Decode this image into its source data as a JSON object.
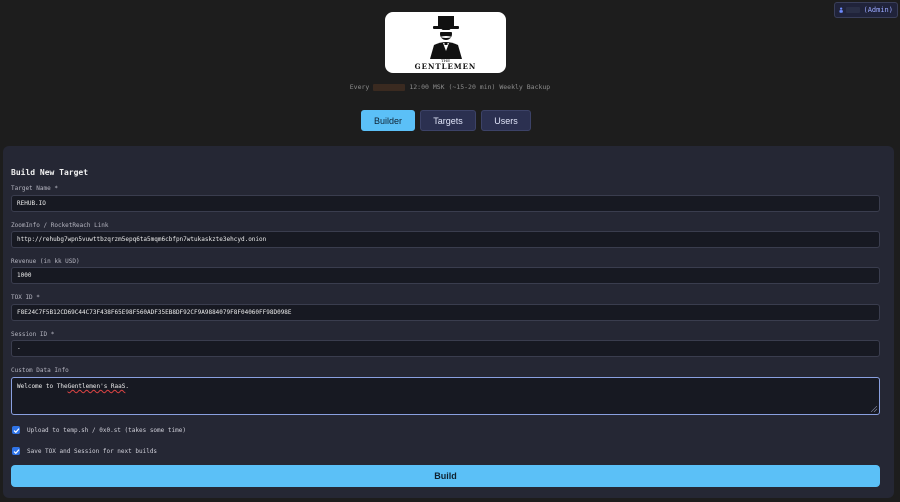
{
  "user": {
    "role": "(Admin)"
  },
  "logo": {
    "small": "THE",
    "big": "GENTLEMEN"
  },
  "backup": {
    "prefix": "Every",
    "suffix": "12:00 MSK (~15-20 min) Weekly Backup"
  },
  "nav": {
    "builder": "Builder",
    "targets": "Targets",
    "users": "Users"
  },
  "form": {
    "title": "Build New Target",
    "target_name_label": "Target Name *",
    "target_name_value": "REHUB.IO",
    "zoominfo_label": "ZoomInfo / RocketReach Link",
    "zoominfo_value": "http://rehubg7wpn5vuwttbzqrzm5epq6ta5mqm6cbfpn7wtukaskzte3ehcyd.onion",
    "revenue_label": "Revenue (in kk USD)",
    "revenue_value": "1000",
    "tox_label": "TOX ID *",
    "tox_value": "F8E24C7F5B12CD69C44C73F438F65E98F560ADF35EB8DF92CF9A9884079F8F04060FF98D098E",
    "session_label": "Session ID *",
    "session_value": "-",
    "custom_label": "Custom Data Info",
    "custom_value_prefix": "Welcome to The ",
    "custom_value_highlight": "Gentlemen's RaaS",
    "custom_value_suffix": ".",
    "upload_label": "Upload to temp.sh / 0x0.st (takes some time)",
    "save_label": "Save TOX and Session for next builds",
    "build_label": "Build"
  },
  "colors": {
    "accent": "#5bc0f7",
    "checkbox": "#2f73e6",
    "background": "#1d1d1d",
    "card": "#252734"
  }
}
